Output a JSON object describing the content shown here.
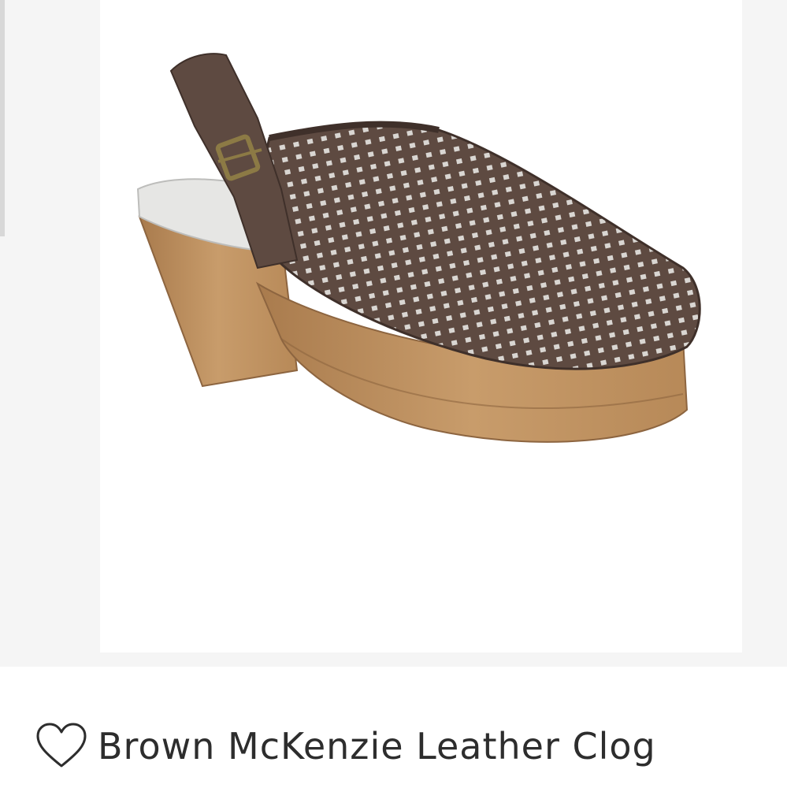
{
  "product": {
    "title": "Brown McKenzie Leather Clog",
    "image_icon": "shoe-product-image",
    "favorite_icon": "heart-outline-icon"
  },
  "colors": {
    "leather": "#5e4a41",
    "leather_dark": "#3f302a",
    "wood": "#c09361",
    "wood_dark": "#8d6540",
    "insole": "#e6e6e4",
    "buckle": "#8c7a45",
    "text": "#2d2d2d"
  }
}
